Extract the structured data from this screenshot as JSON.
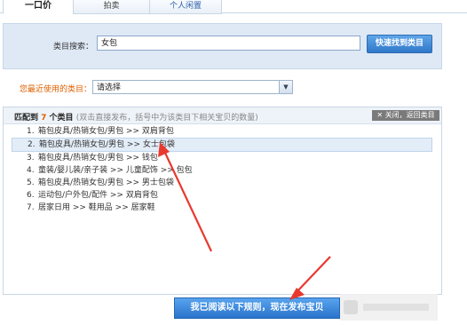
{
  "tabs": [
    {
      "label": "一口价"
    },
    {
      "label": "拍卖"
    },
    {
      "label": "个人闲置"
    }
  ],
  "search": {
    "label": "类目搜索：",
    "value": "女包",
    "button": "快速找到类目"
  },
  "recent": {
    "label": "您最近使用的类目：",
    "selected": "请选择"
  },
  "results": {
    "prefix": "匹配到 ",
    "count": "7",
    "suffix": " 个类目",
    "hint": "(双击直接发布，括号中为该类目下相关宝贝的数量)",
    "close": "✕ 关闭，返回类目",
    "items": [
      {
        "num": "1.",
        "text": "箱包皮具/热销女包/男包 >> 双肩背包"
      },
      {
        "num": "2.",
        "text": "箱包皮具/热销女包/男包 >> 女士包袋"
      },
      {
        "num": "3.",
        "text": "箱包皮具/热销女包/男包 >> 钱包"
      },
      {
        "num": "4.",
        "text": "童装/婴儿装/亲子装 >> 儿童配饰 >> 包包"
      },
      {
        "num": "5.",
        "text": "箱包皮具/热销女包/男包 >> 男士包袋"
      },
      {
        "num": "6.",
        "text": "运动包/户外包/配件 >> 双肩背包"
      },
      {
        "num": "7.",
        "text": "居家日用 >> 鞋用品 >> 居家鞋"
      }
    ]
  },
  "publish_button": "我已阅读以下规则，现在发布宝贝",
  "colors": {
    "accent": "#2f78c9",
    "arrow": "#e8392f",
    "highlight": "#e06000"
  }
}
